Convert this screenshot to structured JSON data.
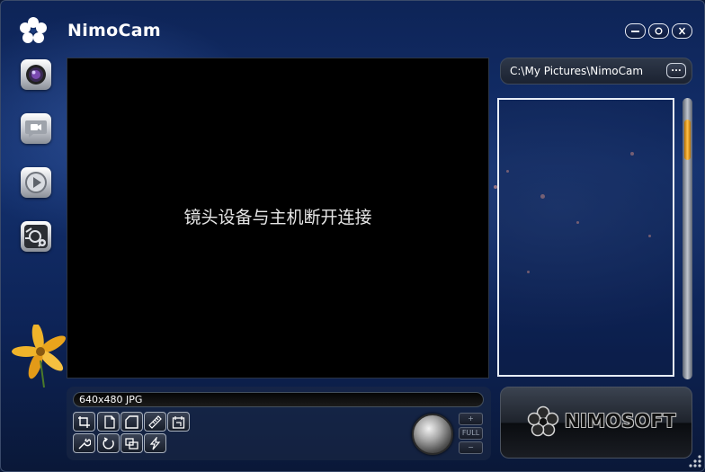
{
  "app": {
    "title": "NimoCam"
  },
  "window_controls": [
    {
      "name": "minimize-button",
      "icon": "minimize-icon"
    },
    {
      "name": "maximize-button",
      "icon": "maximize-icon"
    },
    {
      "name": "close-button",
      "icon": "close-icon"
    }
  ],
  "nav": [
    {
      "name": "nav-camera",
      "icon": "camera-lens-icon"
    },
    {
      "name": "nav-video",
      "icon": "video-chat-icon"
    },
    {
      "name": "nav-play",
      "icon": "play-icon"
    },
    {
      "name": "nav-settings",
      "icon": "settings-icon"
    }
  ],
  "preview": {
    "message": "镜头设备与主机断开连接"
  },
  "status": {
    "format": "640x480 JPG"
  },
  "toolbar": {
    "row1": [
      "crop-icon",
      "copy-icon",
      "frame-icon",
      "ruler-icon",
      "timer-icon"
    ],
    "row2": [
      "wrench-icon",
      "rotate-icon",
      "overlay-icon",
      "flash-icon"
    ]
  },
  "zoom": {
    "plus": "+",
    "full": "FULL",
    "minus": "−"
  },
  "save_path": {
    "value": "C:\\My Pictures\\NimoCam",
    "browse_label": "..."
  },
  "brand": {
    "name": "NIMOSOFT"
  },
  "colors": {
    "scroll_thumb": "#ffb020",
    "window_bg": "#13306d"
  }
}
